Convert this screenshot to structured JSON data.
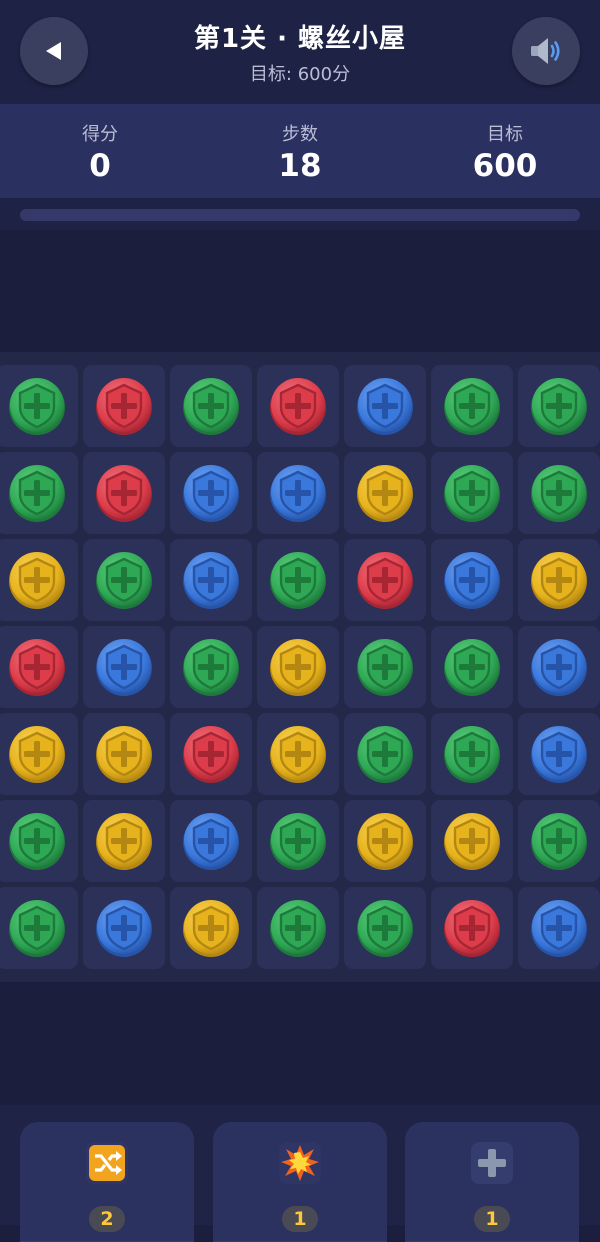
{
  "header": {
    "title": "第1关 · 螺丝小屋",
    "subtitle": "目标: 600分",
    "back_icon": "back-arrow-icon",
    "sound_icon": "speaker-icon"
  },
  "stats": {
    "score_label": "得分",
    "score_value": "0",
    "moves_label": "步数",
    "moves_value": "18",
    "target_label": "目标",
    "target_value": "600"
  },
  "progress": {
    "fraction": 0
  },
  "colors": {
    "green": "#2fa856",
    "red": "#dd3c4a",
    "blue": "#3a78dc",
    "yellow": "#e7b31c"
  },
  "board": {
    "rows": [
      [
        "green",
        "red",
        "green",
        "red",
        "blue",
        "green",
        "green"
      ],
      [
        "green",
        "red",
        "blue",
        "blue",
        "yellow",
        "green",
        "green"
      ],
      [
        "yellow",
        "green",
        "blue",
        "green",
        "red",
        "blue",
        "yellow"
      ],
      [
        "red",
        "blue",
        "green",
        "yellow",
        "green",
        "green",
        "blue"
      ],
      [
        "yellow",
        "yellow",
        "red",
        "yellow",
        "green",
        "green",
        "blue"
      ],
      [
        "green",
        "yellow",
        "blue",
        "green",
        "yellow",
        "yellow",
        "green"
      ],
      [
        "green",
        "blue",
        "yellow",
        "green",
        "green",
        "red",
        "blue"
      ]
    ]
  },
  "tools": [
    {
      "icon": "shuffle-icon",
      "count": "2"
    },
    {
      "icon": "explosion-icon",
      "count": "1"
    },
    {
      "icon": "plus-icon",
      "count": "1"
    }
  ]
}
